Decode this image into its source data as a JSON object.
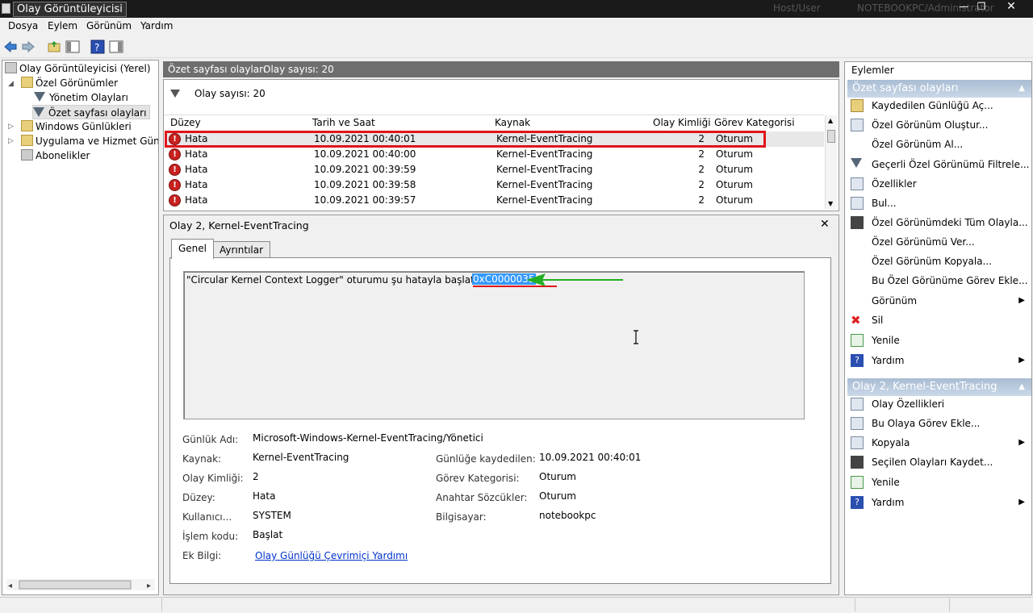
{
  "window": {
    "title": "Olay Görüntüleyicisi",
    "host_label": "Host/User",
    "machine_label": "NOTEBOOKPC/Administrator"
  },
  "menu": [
    "Dosya",
    "Eylem",
    "Görünüm",
    "Yardım"
  ],
  "tree": {
    "root": "Olay Görüntüleyicisi (Yerel)",
    "custom_views": "Özel Görünümler",
    "admin_events": "Yönetim Olayları",
    "summary_events": "Özet sayfası olayları",
    "windows_logs": "Windows Günlükleri",
    "app_logs": "Uygulama ve Hizmet Günlükleri",
    "subscriptions": "Abonelikler"
  },
  "header": {
    "title": "Özet sayfası olayları",
    "count": "Olay sayısı: 20"
  },
  "filter_text": "Olay sayısı: 20",
  "columns": [
    "Düzey",
    "Tarih ve Saat",
    "Kaynak",
    "Olay Kimliği",
    "Görev Kategorisi"
  ],
  "events": [
    {
      "level": "Hata",
      "datetime": "10.09.2021 00:40:01",
      "source": "Kernel-EventTracing",
      "id": "2",
      "category": "Oturum"
    },
    {
      "level": "Hata",
      "datetime": "10.09.2021 00:40:00",
      "source": "Kernel-EventTracing",
      "id": "2",
      "category": "Oturum"
    },
    {
      "level": "Hata",
      "datetime": "10.09.2021 00:39:59",
      "source": "Kernel-EventTracing",
      "id": "2",
      "category": "Oturum"
    },
    {
      "level": "Hata",
      "datetime": "10.09.2021 00:39:58",
      "source": "Kernel-EventTracing",
      "id": "2",
      "category": "Oturum"
    },
    {
      "level": "Hata",
      "datetime": "10.09.2021 00:39:57",
      "source": "Kernel-EventTracing",
      "id": "2",
      "category": "Oturum"
    }
  ],
  "detail": {
    "title": "Olay 2, Kernel-EventTracing",
    "tab_general": "Genel",
    "tab_details": "Ayrıntılar",
    "description": "\"Circular Kernel Context Logger\" oturumu şu hatayla başlatılamadı:",
    "error_code": "0xC0000035",
    "props": {
      "log_name_label": "Günlük Adı:",
      "log_name": "Microsoft-Windows-Kernel-EventTracing/Yönetici",
      "source_label": "Kaynak:",
      "source": "Kernel-EventTracing",
      "logged_label": "Günlüğe kaydedilen:",
      "logged": "10.09.2021 00:40:01",
      "event_id_label": "Olay Kimliği:",
      "event_id": "2",
      "task_label": "Görev Kategorisi:",
      "task": "Oturum",
      "level_label": "Düzey:",
      "level": "Hata",
      "keywords_label": "Anahtar Sözcükler:",
      "keywords": "Oturum",
      "user_label": "Kullanıcı...",
      "user": "SYSTEM",
      "computer_label": "Bilgisayar:",
      "computer": "notebookpc",
      "opcode_label": "İşlem kodu:",
      "opcode": "Başlat",
      "more_info_label": "Ek Bilgi:",
      "more_info_link": "Olay Günlüğü Çevrimiçi Yardımı"
    }
  },
  "actions": {
    "title": "Eylemler",
    "section1": "Özet sayfası olayları",
    "items1": [
      "Kaydedilen Günlüğü Aç...",
      "Özel Görünüm Oluştur...",
      "Özel Görünüm Al...",
      "Geçerli Özel Görünümü Filtrele...",
      "Özellikler",
      "Bul...",
      "Özel Görünümdeki Tüm Olayla...",
      "Özel Görünümü Ver...",
      "Özel Görünüm Kopyala...",
      "Bu Özel Görünüme Görev Ekle...",
      "Görünüm",
      "Sil",
      "Yenile",
      "Yardım"
    ],
    "section2": "Olay 2, Kernel-EventTracing",
    "items2": [
      "Olay Özellikleri",
      "Bu Olaya Görev Ekle...",
      "Kopyala",
      "Seçilen Olayları Kaydet...",
      "Yenile",
      "Yardım"
    ]
  },
  "colors": {
    "highlight_box": "#e0141a",
    "arrow": "#22b022",
    "selection": "#3399ff",
    "link": "#0033cc"
  }
}
